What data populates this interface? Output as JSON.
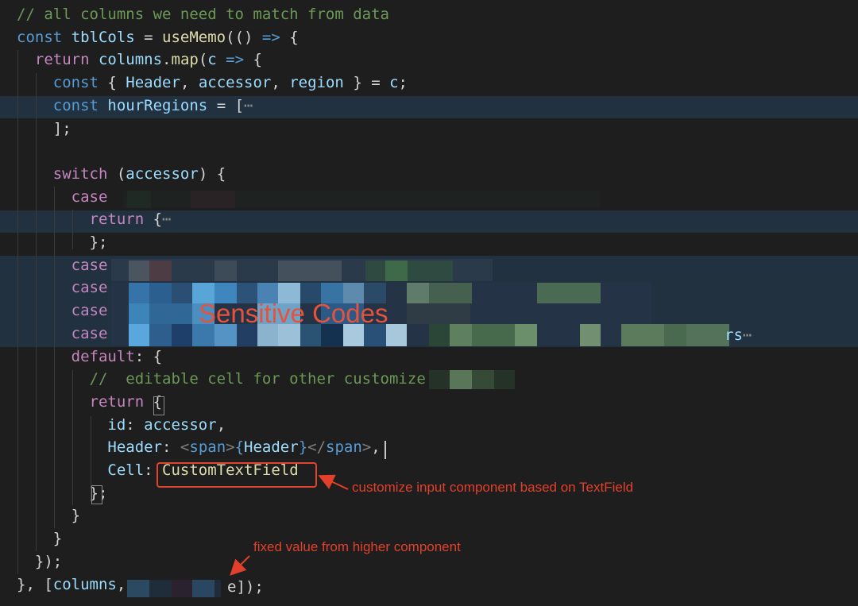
{
  "code_lines": [
    {
      "tokens": [
        {
          "t": "// all columns we need to match from data",
          "c": "com"
        }
      ]
    },
    {
      "tokens": [
        {
          "t": "const ",
          "c": "kw"
        },
        {
          "t": "tblCols",
          "c": "var"
        },
        {
          "t": " = ",
          "c": "pl"
        },
        {
          "t": "useMemo",
          "c": "fn"
        },
        {
          "t": "(() ",
          "c": "pl"
        },
        {
          "t": "=>",
          "c": "kw"
        },
        {
          "t": " {",
          "c": "pl"
        }
      ]
    },
    {
      "tokens": [
        {
          "t": "  ",
          "c": "pl"
        },
        {
          "t": "return ",
          "c": "ctl"
        },
        {
          "t": "columns",
          "c": "var"
        },
        {
          "t": ".",
          "c": "pl"
        },
        {
          "t": "map",
          "c": "fn"
        },
        {
          "t": "(",
          "c": "pl"
        },
        {
          "t": "c",
          "c": "var"
        },
        {
          "t": " => ",
          "c": "kw"
        },
        {
          "t": "{",
          "c": "pl"
        }
      ]
    },
    {
      "tokens": [
        {
          "t": "    ",
          "c": "pl"
        },
        {
          "t": "const ",
          "c": "kw"
        },
        {
          "t": "{ ",
          "c": "pl"
        },
        {
          "t": "Header",
          "c": "var"
        },
        {
          "t": ", ",
          "c": "pl"
        },
        {
          "t": "accessor",
          "c": "var"
        },
        {
          "t": ", ",
          "c": "pl"
        },
        {
          "t": "region",
          "c": "var"
        },
        {
          "t": " } = ",
          "c": "pl"
        },
        {
          "t": "c",
          "c": "var"
        },
        {
          "t": ";",
          "c": "pl"
        }
      ]
    },
    {
      "tokens": [
        {
          "t": "    ",
          "c": "pl"
        },
        {
          "t": "const ",
          "c": "kw"
        },
        {
          "t": "hourRegions",
          "c": "var"
        },
        {
          "t": " = [",
          "c": "pl"
        },
        {
          "t": "⋯",
          "c": "fold"
        }
      ]
    },
    {
      "tokens": [
        {
          "t": "    ];",
          "c": "pl"
        }
      ]
    },
    {
      "tokens": []
    },
    {
      "tokens": [
        {
          "t": "    ",
          "c": "pl"
        },
        {
          "t": "switch ",
          "c": "ctl"
        },
        {
          "t": "(",
          "c": "pl"
        },
        {
          "t": "accessor",
          "c": "var"
        },
        {
          "t": ") {",
          "c": "pl"
        }
      ]
    },
    {
      "tokens": [
        {
          "t": "      ",
          "c": "pl"
        },
        {
          "t": "case",
          "c": "ctl"
        }
      ]
    },
    {
      "tokens": [
        {
          "t": "        ",
          "c": "pl"
        },
        {
          "t": "return ",
          "c": "ctl"
        },
        {
          "t": "{",
          "c": "pl"
        },
        {
          "t": "⋯",
          "c": "fold"
        }
      ]
    },
    {
      "tokens": [
        {
          "t": "        };",
          "c": "pl"
        }
      ]
    },
    {
      "tokens": [
        {
          "t": "      ",
          "c": "pl"
        },
        {
          "t": "case",
          "c": "ctl"
        }
      ]
    },
    {
      "tokens": [
        {
          "t": "      ",
          "c": "pl"
        },
        {
          "t": "case",
          "c": "ctl"
        }
      ]
    },
    {
      "tokens": [
        {
          "t": "      ",
          "c": "pl"
        },
        {
          "t": "case",
          "c": "ctl"
        }
      ]
    },
    {
      "tokens": [
        {
          "t": "      ",
          "c": "pl"
        },
        {
          "t": "case",
          "c": "ctl"
        }
      ]
    },
    {
      "tokens": [
        {
          "t": "      ",
          "c": "pl"
        },
        {
          "t": "default",
          "c": "ctl"
        },
        {
          "t": ": {",
          "c": "pl"
        }
      ]
    },
    {
      "tokens": [
        {
          "t": "        //  editable cell for other customize",
          "c": "com"
        }
      ]
    },
    {
      "tokens": [
        {
          "t": "        ",
          "c": "pl"
        },
        {
          "t": "return ",
          "c": "ctl"
        },
        {
          "t": "{",
          "c": "pl"
        }
      ]
    },
    {
      "tokens": [
        {
          "t": "          ",
          "c": "pl"
        },
        {
          "t": "id",
          "c": "var"
        },
        {
          "t": ": ",
          "c": "pl"
        },
        {
          "t": "accessor",
          "c": "var"
        },
        {
          "t": ",",
          "c": "pl"
        }
      ]
    },
    {
      "tokens": [
        {
          "t": "          ",
          "c": "pl"
        },
        {
          "t": "Header",
          "c": "var"
        },
        {
          "t": ": ",
          "c": "pl"
        },
        {
          "t": "<",
          "c": "ang"
        },
        {
          "t": "span",
          "c": "tag"
        },
        {
          "t": ">",
          "c": "ang"
        },
        {
          "t": "{",
          "c": "kw"
        },
        {
          "t": "Header",
          "c": "var"
        },
        {
          "t": "}",
          "c": "kw"
        },
        {
          "t": "</",
          "c": "ang"
        },
        {
          "t": "span",
          "c": "tag"
        },
        {
          "t": ">",
          "c": "ang"
        },
        {
          "t": ",",
          "c": "pl"
        }
      ]
    },
    {
      "tokens": [
        {
          "t": "          ",
          "c": "pl"
        },
        {
          "t": "Cell",
          "c": "var"
        },
        {
          "t": ": ",
          "c": "pl"
        },
        {
          "t": "CustomTextField",
          "c": "fn"
        }
      ]
    },
    {
      "tokens": [
        {
          "t": "        };",
          "c": "pl"
        }
      ]
    },
    {
      "tokens": [
        {
          "t": "      }",
          "c": "pl"
        }
      ]
    },
    {
      "tokens": [
        {
          "t": "    }",
          "c": "pl"
        }
      ]
    },
    {
      "tokens": [
        {
          "t": "  });",
          "c": "pl"
        }
      ]
    },
    {
      "tokens": [
        {
          "t": "}, [",
          "c": "pl"
        },
        {
          "t": "columns",
          "c": "var"
        },
        {
          "t": ",",
          "c": "pl"
        }
      ]
    }
  ],
  "tail_fragments": {
    "line14_tail": "rs",
    "line25_tail": "e]);"
  },
  "annotations": {
    "sensitive": "Sensitive Codes",
    "cell_note": "customize input component based on TextField",
    "fixed_note": "fixed value from higher component"
  },
  "colors": {
    "background": "#1e1e1e",
    "line_highlight": "#223140",
    "annotation_red": "#e3402b",
    "keyword_blue": "#569cd6",
    "control_purple": "#c586c0",
    "variable_lightblue": "#9cdcfe",
    "function_yellow": "#dcdcaa",
    "comment_green": "#6a9955"
  }
}
